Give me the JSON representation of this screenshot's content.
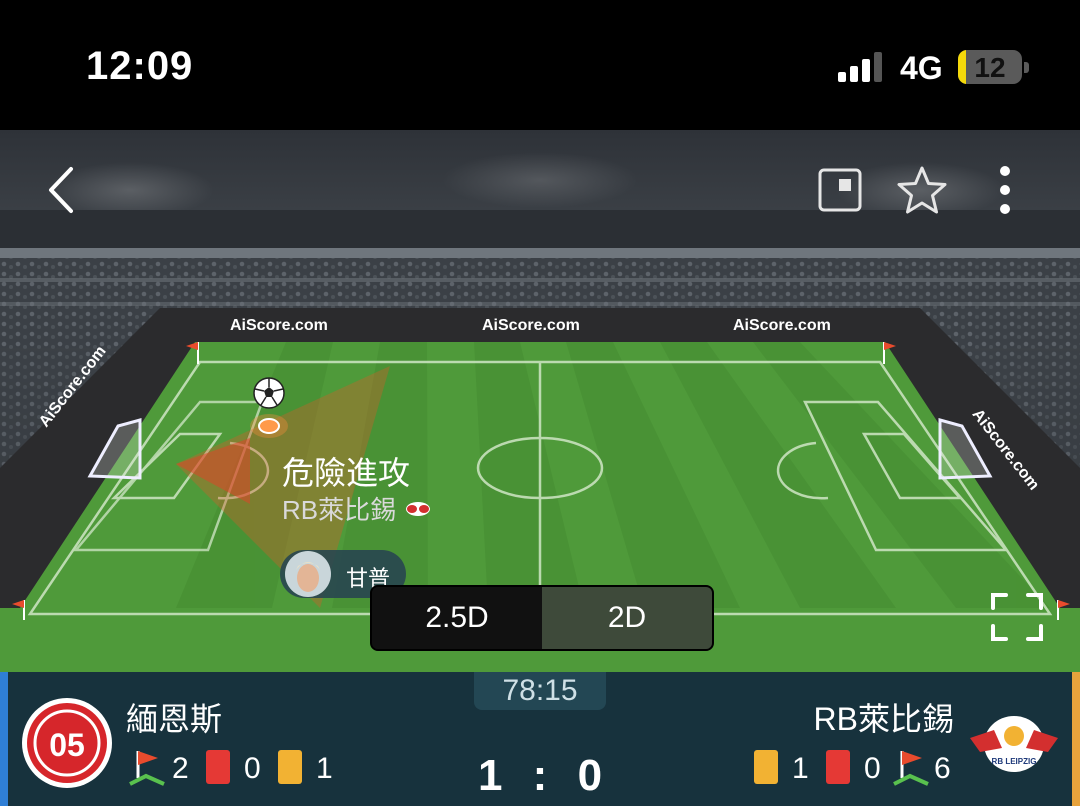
{
  "status_bar": {
    "time": "12:09",
    "network": "4G",
    "battery": "12",
    "battery_level": 0.12
  },
  "nav": {
    "back_icon": "chevron-left-icon",
    "pip_icon": "picture-in-picture-icon",
    "favorite_icon": "star-icon",
    "more_icon": "more-vertical-icon"
  },
  "pitch": {
    "ad_boards": [
      "AiScore.com",
      "AiScore.com",
      "AiScore.com",
      "AiScore.com",
      "AiScore.com"
    ],
    "event_title": "危險進攻",
    "event_team": "RB萊比錫",
    "player_name": "甘普",
    "fullscreen_icon": "fullscreen-icon"
  },
  "view_toggle": {
    "options": [
      "2.5D",
      "2D"
    ],
    "selected": "2D"
  },
  "match": {
    "minute": "78:15",
    "home": {
      "name": "緬恩斯",
      "corners": "2",
      "red_cards": "0",
      "yellow_cards": "1",
      "accent": "#2f7fd6"
    },
    "away": {
      "name": "RB萊比錫",
      "yellow_cards": "1",
      "red_cards": "0",
      "corners": "6",
      "accent": "#e8a33c"
    },
    "score_home": "1",
    "score_sep": ":",
    "score_away": "0"
  },
  "colors": {
    "pitch": "#4f9a3a",
    "panel": "#17323d",
    "red_card": "#e53935",
    "yellow_card": "#f2b233"
  }
}
